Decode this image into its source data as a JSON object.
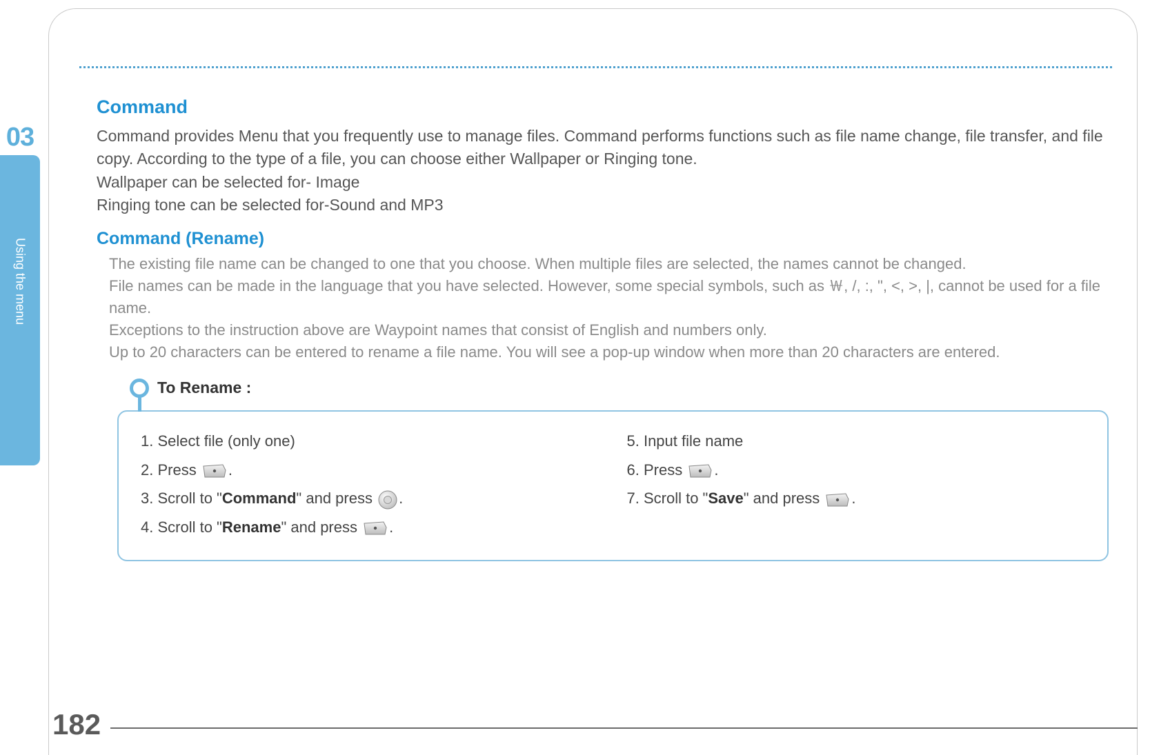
{
  "chapter": {
    "number": "03",
    "label": "Using the menu"
  },
  "page_number": "182",
  "section": {
    "title": "Command",
    "intro_1": "Command provides Menu that you frequently use to manage files. Command performs functions such as file name change, file transfer, and file copy.  According to the type of a file, you can choose either Wallpaper or Ringing tone.",
    "intro_2": "Wallpaper can be selected for- Image",
    "intro_3": "Ringing tone can be selected for-Sound and MP3"
  },
  "subsection": {
    "title": "Command (Rename)",
    "p1": "The existing file name can be changed to one that you choose. When multiple files are selected, the names cannot be changed.",
    "p2": "File names can be made in the language that you have selected.  However, some special symbols, such as ￦, /, :, \", <, >, |, cannot be used for a file name.",
    "p3": "Exceptions to the instruction above are Waypoint names that consist of English and numbers only.",
    "p4": "Up to 20 characters can be entered to rename a file name. You will see a pop-up window when more than 20 characters are entered."
  },
  "steps": {
    "title": "To Rename :",
    "left": {
      "s1": "1.  Select file (only one)",
      "s2_pre": "2.  Press ",
      "s2_post": ".",
      "s3_pre": "3.  Scroll to \"",
      "s3_bold": "Command",
      "s3_mid": "\" and press ",
      "s3_post": ".",
      "s4_pre": "4.  Scroll to \"",
      "s4_bold": "Rename",
      "s4_mid": "\" and press ",
      "s4_post": "."
    },
    "right": {
      "s5": "5.  Input file name",
      "s6_pre": "6.  Press ",
      "s6_post": ".",
      "s7_pre": "7.  Scroll to \"",
      "s7_bold": "Save",
      "s7_mid": "\" and press ",
      "s7_post": "."
    }
  }
}
